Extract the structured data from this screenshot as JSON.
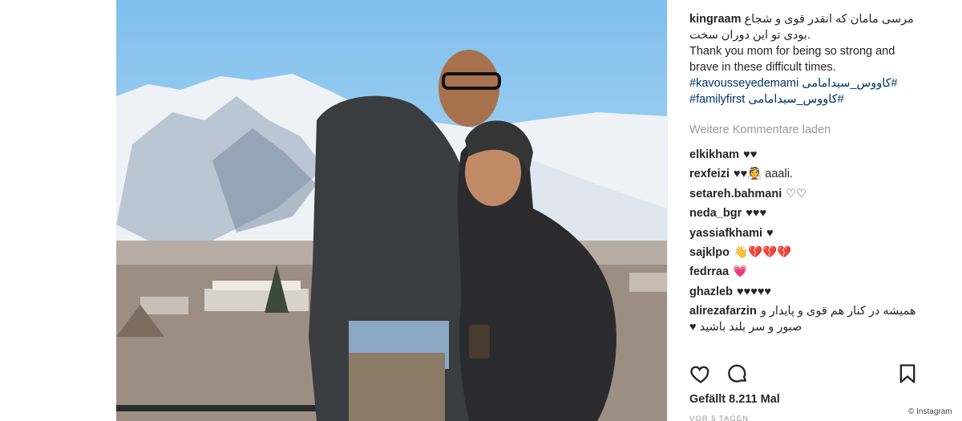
{
  "post": {
    "username": "kingraam",
    "caption_fa": "مرسی مامان که انقدر قوی و شجاع بودی تو این دوران سخت.",
    "caption_en": "Thank you mom for being so strong and brave in these difficult times.",
    "hashtag_1": "#kavousseyedemami",
    "hashtag_1_fa": "#کاووس_سیدامامی",
    "hashtag_2": "#familyfirst",
    "hashtag_2_fa": "#کاووس_سیدامامی",
    "load_more": "Weitere Kommentare laden",
    "likes": "Gefällt 8.211 Mal",
    "time_ago": "VOR 5 TAGEN"
  },
  "comments": [
    {
      "user": "elkikham",
      "text": "♥♥"
    },
    {
      "user": "rexfeizi",
      "text": "♥♥👰 aaali."
    },
    {
      "user": "setareh.bahmani",
      "text": "♡♡"
    },
    {
      "user": "neda_bgr",
      "text": "♥♥♥"
    },
    {
      "user": "yassiafkhami",
      "text": "♥"
    },
    {
      "user": "sajklpo",
      "text": "👋💔💔💔"
    },
    {
      "user": "fedrraa",
      "text": "💗"
    },
    {
      "user": "ghazleb",
      "text": "♥♥♥♥♥"
    },
    {
      "user": "alirezafarzin",
      "text": "همیشه در کنار هم قوی و پایدار و صبور و سر بلند باشید ♥"
    }
  ],
  "icons": {
    "like": "heart-outline-icon",
    "comment": "speech-bubble-icon",
    "save": "bookmark-icon"
  },
  "credit": "© Instagram",
  "colors": {
    "sky": "#9fd0f3",
    "hashtag": "#003569",
    "muted": "#999999",
    "text": "#262626"
  }
}
